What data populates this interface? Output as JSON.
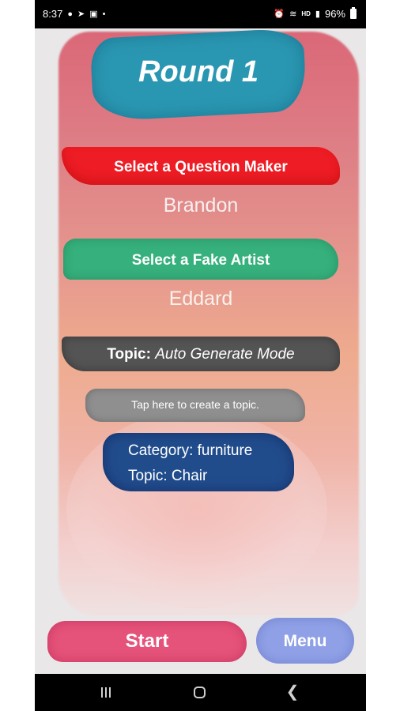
{
  "status_bar": {
    "time": "8:37",
    "battery": "96%",
    "left_icons": [
      "whatsapp-icon",
      "location-icon",
      "gallery-icon",
      "dot-icon"
    ],
    "right_icons": [
      "alarm-icon",
      "wifi-icon",
      "hd-icon",
      "signal-icon",
      "battery-icon"
    ]
  },
  "round": {
    "title": "Round 1"
  },
  "question_maker": {
    "label": "Select a Question Maker",
    "value": "Brandon"
  },
  "fake_artist": {
    "label": "Select a Fake Artist",
    "value": "Eddard"
  },
  "topic_mode": {
    "label_prefix": "Topic:",
    "mode": "Auto Generate Mode"
  },
  "create_topic": {
    "label": "Tap here to create a topic."
  },
  "generated": {
    "category": "Category: furniture",
    "topic": "Topic: Chair"
  },
  "buttons": {
    "start": "Start",
    "menu": "Menu"
  },
  "colors": {
    "round_stroke": "#2a97b2",
    "question_maker_stroke": "#ee1c24",
    "fake_artist_stroke": "#36b07c",
    "topic_stroke": "#545454",
    "create_stroke": "#8f8f8f",
    "generated_stroke": "#214c8c",
    "start_stroke": "#e5527a",
    "menu_stroke": "#8fa0e6"
  }
}
